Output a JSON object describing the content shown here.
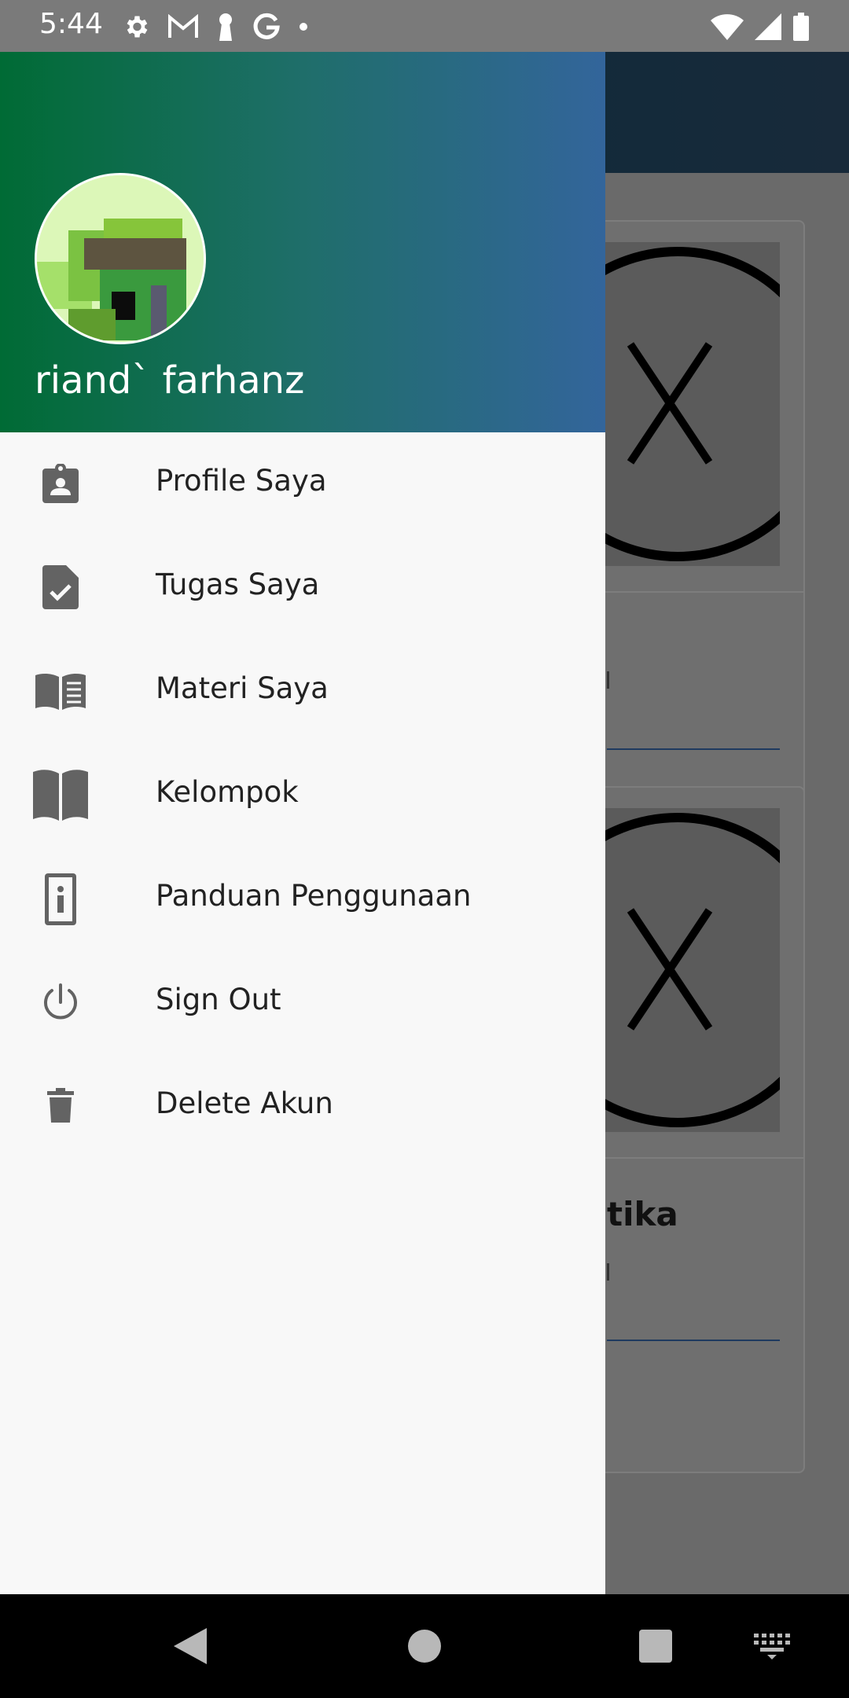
{
  "status_bar": {
    "time": "5:44",
    "left_icons": [
      "gear-icon",
      "gmail-icon",
      "keyhole-icon",
      "google-icon",
      "dot-icon"
    ],
    "right_icons": [
      "wifi-icon",
      "signal-icon",
      "battery-icon"
    ]
  },
  "drawer": {
    "header": {
      "user_name": "riand` farhanz",
      "gradient_colors": [
        "#006b35",
        "#33659b"
      ]
    },
    "items": [
      {
        "label": "Profile Saya",
        "icon": "profile-badge-icon"
      },
      {
        "label": "Tugas Saya",
        "icon": "task-document-icon"
      },
      {
        "label": "Materi Saya",
        "icon": "open-book-lines-icon"
      },
      {
        "label": "Kelompok",
        "icon": "book-open-icon"
      },
      {
        "label": "Panduan Penggunaan",
        "icon": "info-document-icon"
      },
      {
        "label": "Sign Out",
        "icon": "power-icon"
      },
      {
        "label": "Delete Akun",
        "icon": "trash-icon"
      }
    ]
  },
  "background": {
    "card_title_fragment": "tika"
  },
  "nav_bar": {
    "buttons": [
      "back-icon",
      "home-icon",
      "recents-icon",
      "keyboard-icon"
    ]
  }
}
